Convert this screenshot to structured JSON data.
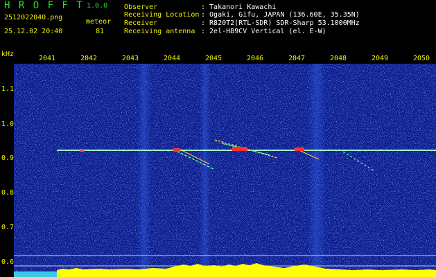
{
  "header": {
    "app_title": "H R O F F T",
    "version": "1.0.0",
    "filename": "2512022040.png",
    "datetime": "25.12.02 20:40",
    "detection_type": "meteor",
    "count": "81"
  },
  "info": [
    {
      "key": "Observer",
      "value": ": Takanori Kawachi"
    },
    {
      "key": "Receiving Location",
      "value": ": Ogaki, Gifu, JAPAN (136.60E, 35.35N)"
    },
    {
      "key": "Receiver",
      "value": ": R820T2(RTL-SDR) SDR-Sharp 53.1000MHz"
    },
    {
      "key": "Receiving antenna",
      "value": ": 2el-HB9CV Vertical (el. E-W)"
    }
  ],
  "axes": {
    "y_unit": "kHz",
    "y_ticks": [
      "1.1",
      "1.0",
      "0.9",
      "0.8",
      "0.7",
      "0.6"
    ],
    "x_ticks": [
      "2041",
      "2042",
      "2043",
      "2044",
      "2045",
      "2046",
      "2047",
      "2048",
      "2049",
      "2050"
    ]
  },
  "colors": {
    "background": "#0a1a8c",
    "title": "#22e022",
    "labels": "#f0f000",
    "carrier": "#a0ffd0",
    "meteor_head": "#ff3030",
    "spectrum": "#ffff00"
  }
}
